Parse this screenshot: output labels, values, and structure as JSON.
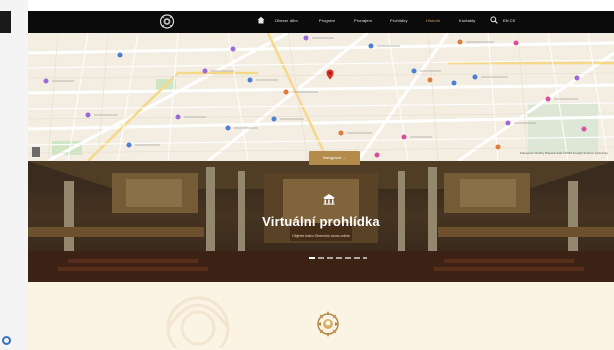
{
  "nav": {
    "items": [
      {
        "label": "Obecní dům"
      },
      {
        "label": "Program"
      },
      {
        "label": "Pronájem"
      },
      {
        "label": "Prohlídky"
      },
      {
        "label": "Historie"
      },
      {
        "label": "Kontakty"
      }
    ],
    "language": "EN  CS",
    "accent": "#c9a45e"
  },
  "map": {
    "navigate_button": "Navigovat",
    "footer": "Klávesové zkratky  Mapová data ©2024 Google  Smluvní podmínky",
    "marker_color": "#d93025"
  },
  "tour": {
    "title": "Virtuální prohlídka",
    "subtitle": "Objevte krásu Obecního domu online"
  }
}
